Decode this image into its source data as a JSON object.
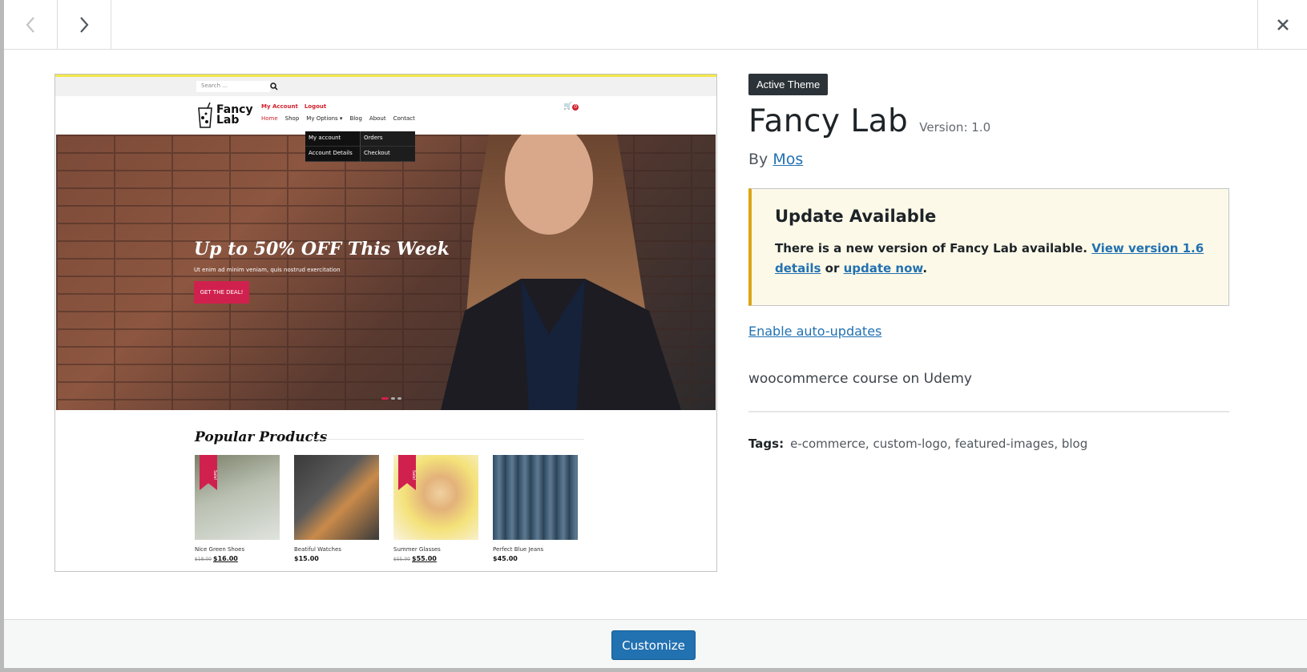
{
  "nav": {
    "prev_label": "Show previous theme",
    "next_label": "Show next theme",
    "close_label": "Close details dialog"
  },
  "preview": {
    "search_placeholder": "Search ...",
    "logo_line1": "Fancy",
    "logo_line2": "Lab",
    "account_links": [
      "My Account",
      "Logout"
    ],
    "menu": [
      "Home",
      "Shop",
      "My Options ▾",
      "Blog",
      "About",
      "Contact"
    ],
    "cart_count": "0",
    "dropdown": [
      [
        "My account",
        "Orders"
      ],
      [
        "Account Details",
        "Checkout"
      ]
    ],
    "hero_title": "Up to 50% OFF This Week",
    "hero_subtitle": "Ut enim ad minim veniam, quis nostrud exercitation",
    "hero_button": "GET THE DEAL!",
    "popular_title": "Popular Products",
    "products": [
      {
        "name": "Nice Green Shoes",
        "old_price": "$18.00",
        "price": "$16.00",
        "sale": true,
        "sale_label": "Sale!"
      },
      {
        "name": "Beatiful Watches",
        "old_price": "",
        "price": "$15.00",
        "sale": false,
        "sale_label": ""
      },
      {
        "name": "Summer Glasses",
        "old_price": "$55.00",
        "price": "$55.00",
        "sale": true,
        "sale_label": "Sale!"
      },
      {
        "name": "Perfect Blue Jeans",
        "old_price": "",
        "price": "$45.00",
        "sale": false,
        "sale_label": ""
      }
    ]
  },
  "theme": {
    "active_badge": "Active Theme",
    "name": "Fancy Lab",
    "version": "Version: 1.0",
    "by": "By",
    "author": "Mos",
    "notice_title": "Update Available",
    "notice_text": "There is a new version of Fancy Lab available.",
    "notice_link": "View version 1.6 details",
    "notice_or": "or",
    "notice_update_link": "update now",
    "notice_end": ".",
    "auto_updates": "Enable auto-updates",
    "description": "woocommerce course on Udemy",
    "tags_label": "Tags:",
    "tags": "e-commerce, custom-logo, featured-images, blog"
  },
  "footer": {
    "customize_label": "Customize"
  },
  "colors": {
    "primary": "#2271b1",
    "notice_border": "#dba617",
    "notice_bg": "#fcf9e8",
    "badge_bg": "#2c3338",
    "accent_red": "#d0214e"
  }
}
